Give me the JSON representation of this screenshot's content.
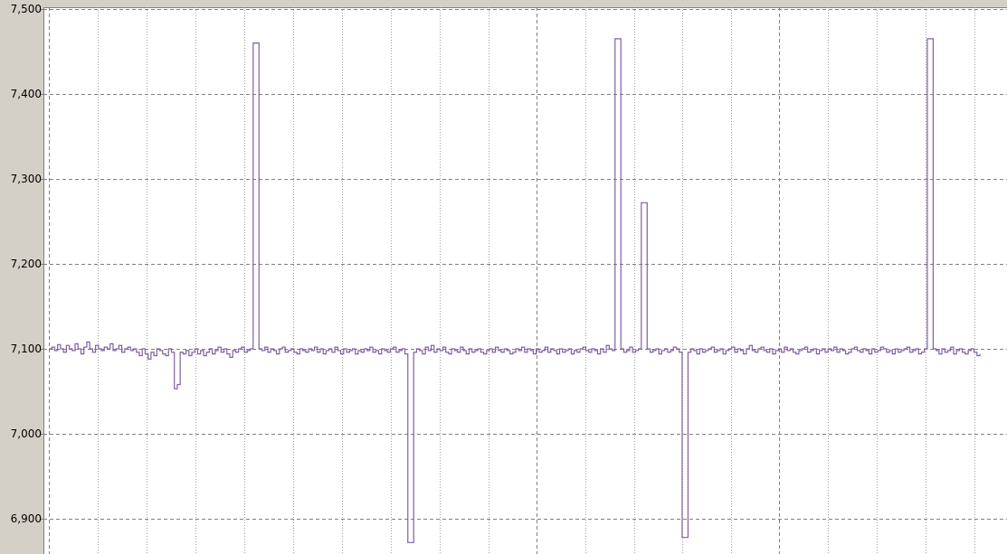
{
  "chart_data": {
    "type": "line",
    "title": "",
    "xlabel": "",
    "ylabel": "",
    "ylim": [
      6875,
      7500
    ],
    "y_ticks": [
      "7,500",
      "7,400",
      "7,300",
      "7,200",
      "7,100",
      "7,000",
      "6,900"
    ],
    "y_tick_values": [
      7500,
      7400,
      7300,
      7200,
      7100,
      7000,
      6900
    ],
    "grid": true,
    "legend": "none",
    "colors": {
      "background": "#d4d0c8",
      "plot_background": "#ffffff",
      "line": "#8060a0",
      "grid_dashed": "#808080",
      "grid_dotted": "#a0a0a0"
    },
    "series": [
      {
        "values": [
          7100,
          7102,
          7098,
          7105,
          7100,
          7096,
          7104,
          7100,
          7098,
          7106,
          7100,
          7094,
          7102,
          7108,
          7100,
          7096,
          7104,
          7100,
          7098,
          7102,
          7100,
          7106,
          7098,
          7100,
          7104,
          7096,
          7100,
          7102,
          7098,
          7100,
          7096,
          7092,
          7100,
          7094,
          7088,
          7096,
          7092,
          7100,
          7098,
          7094,
          7092,
          7100,
          7096,
          7053,
          7058,
          7096,
          7094,
          7098,
          7092,
          7096,
          7100,
          7094,
          7098,
          7092,
          7096,
          7100,
          7094,
          7098,
          7102,
          7096,
          7100,
          7094,
          7090,
          7098,
          7096,
          7100,
          7102,
          7096,
          7098,
          7100,
          7460,
          7460,
          7100,
          7098,
          7102,
          7096,
          7100,
          7098,
          7094,
          7100,
          7102,
          7096,
          7098,
          7100,
          7096,
          7094,
          7100,
          7098,
          7096,
          7100,
          7098,
          7102,
          7096,
          7100,
          7094,
          7098,
          7100,
          7096,
          7102,
          7098,
          7094,
          7100,
          7096,
          7098,
          7100,
          7094,
          7098,
          7096,
          7100,
          7098,
          7102,
          7096,
          7098,
          7094,
          7100,
          7098,
          7096,
          7100,
          7102,
          7096,
          7098,
          7100,
          7094,
          6872,
          6872,
          7096,
          7100,
          7098,
          7094,
          7102,
          7098,
          7104,
          7096,
          7100,
          7098,
          7102,
          7096,
          7094,
          7100,
          7098,
          7096,
          7102,
          7098,
          7094,
          7100,
          7096,
          7098,
          7100,
          7096,
          7094,
          7098,
          7100,
          7096,
          7102,
          7098,
          7096,
          7100,
          7098,
          7094,
          7096,
          7100,
          7098,
          7102,
          7096,
          7100,
          7098,
          7094,
          7100,
          7096,
          7098,
          7102,
          7096,
          7100,
          7098,
          7094,
          7100,
          7096,
          7098,
          7100,
          7094,
          7098,
          7096,
          7100,
          7102,
          7098,
          7096,
          7100,
          7098,
          7094,
          7100,
          7096,
          7104,
          7100,
          7098,
          7465,
          7465,
          7100,
          7096,
          7098,
          7102,
          7096,
          7098,
          7100,
          7272,
          7272,
          7100,
          7096,
          7098,
          7100,
          7094,
          7098,
          7100,
          7096,
          7098,
          7102,
          7100,
          7096,
          6878,
          6878,
          7096,
          7100,
          7098,
          7094,
          7100,
          7096,
          7098,
          7100,
          7102,
          7096,
          7098,
          7100,
          7094,
          7098,
          7100,
          7102,
          7096,
          7100,
          7098,
          7094,
          7100,
          7104,
          7098,
          7096,
          7100,
          7102,
          7098,
          7096,
          7100,
          7094,
          7098,
          7100,
          7096,
          7102,
          7098,
          7100,
          7096,
          7094,
          7098,
          7100,
          7102,
          7096,
          7098,
          7100,
          7094,
          7098,
          7100,
          7096,
          7100,
          7098,
          7102,
          7096,
          7100,
          7098,
          7094,
          7096,
          7100,
          7102,
          7098,
          7096,
          7100,
          7098,
          7094,
          7100,
          7096,
          7098,
          7102,
          7100,
          7096,
          7098,
          7094,
          7100,
          7096,
          7098,
          7100,
          7102,
          7096,
          7098,
          7100,
          7094,
          7096,
          7100,
          7465,
          7465,
          7100,
          7098,
          7094,
          7100,
          7096,
          7098,
          7102,
          7094,
          7098,
          7100,
          7096,
          7094,
          7098,
          7100,
          7096,
          7092,
          7094
        ]
      }
    ]
  }
}
